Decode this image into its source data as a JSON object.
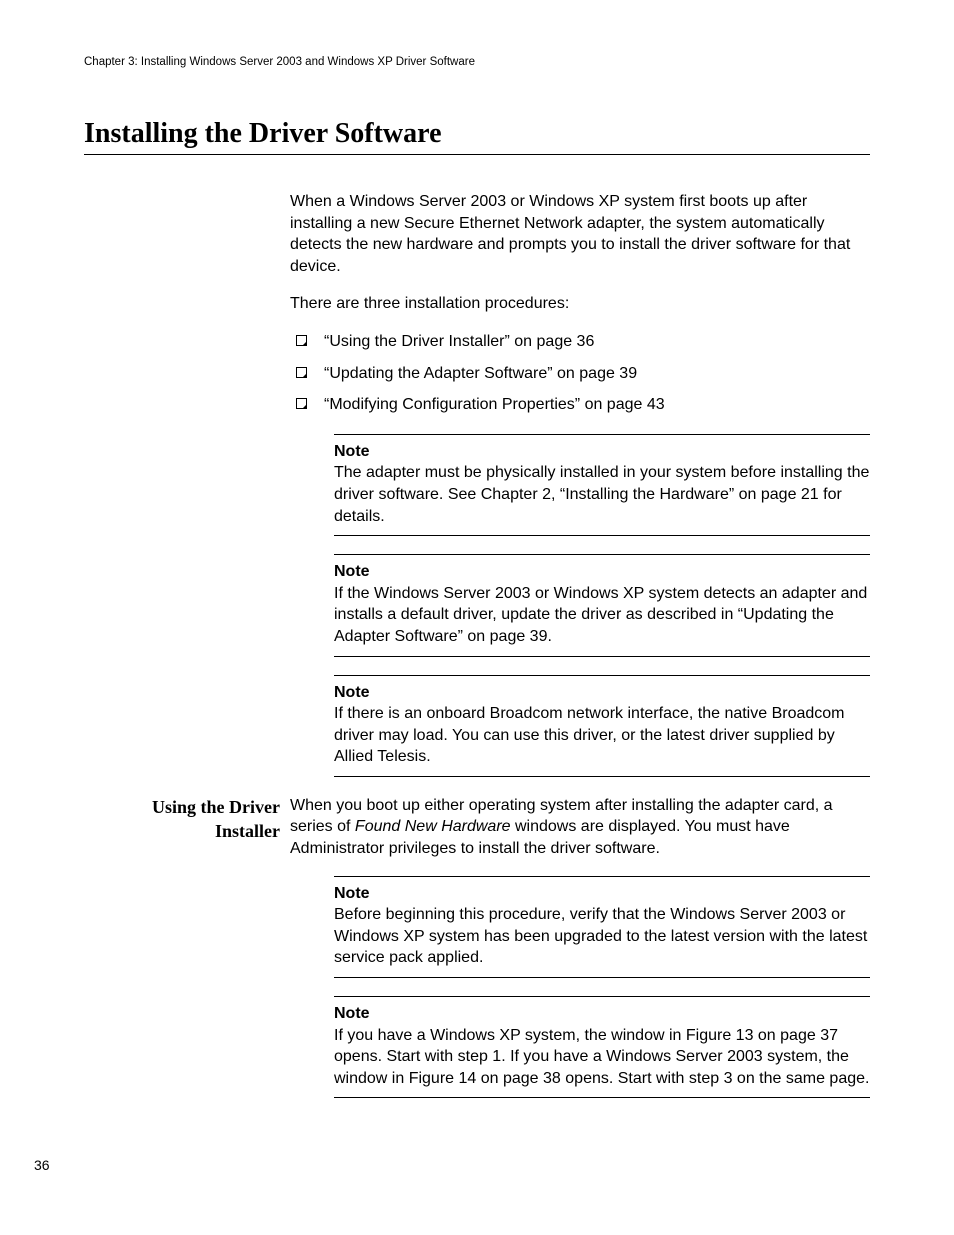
{
  "running_head": "Chapter 3: Installing Windows Server 2003 and Windows XP Driver Software",
  "title": "Installing the Driver Software",
  "intro_para": "When a Windows Server 2003 or Windows XP system first boots up after installing a new Secure Ethernet Network adapter, the system automatically detects the new hardware and prompts you to install the driver software for that device.",
  "procedures_intro": "There are three installation procedures:",
  "procedures": [
    "“Using the Driver Installer” on page 36",
    "“Updating the Adapter Software” on page 39",
    "“Modifying Configuration Properties” on page 43"
  ],
  "notes_group1": [
    {
      "title": "Note",
      "body": "The adapter must be physically installed in your system before installing the driver software. See Chapter 2, “Installing the Hardware” on page 21 for details."
    },
    {
      "title": "Note",
      "body": "If the Windows Server 2003 or Windows XP system detects an adapter and installs a default driver, update the driver as described in “Updating the Adapter Software” on page 39."
    },
    {
      "title": "Note",
      "body": "If there is an onboard Broadcom network interface, the native Broadcom driver may load. You can use this driver, or the latest driver supplied by Allied Telesis."
    }
  ],
  "section2": {
    "side_heading_line1": "Using the Driver",
    "side_heading_line2": "Installer",
    "para_prefix": "When you boot up either operating system after installing the adapter card, a series of ",
    "para_italic": "Found New Hardware",
    "para_suffix": " windows are displayed. You must have Administrator privileges to install the driver software.",
    "notes": [
      {
        "title": "Note",
        "body": "Before beginning this procedure, verify that the Windows Server 2003 or Windows XP system has been upgraded to the latest version with the latest service pack applied."
      },
      {
        "title": "Note",
        "body": "If you have a Windows XP system, the window in Figure 13 on page 37 opens. Start with step 1. If you have a Windows Server 2003 system, the window in Figure 14 on page 38 opens. Start with step 3 on the same page."
      }
    ]
  },
  "page_number": "36"
}
